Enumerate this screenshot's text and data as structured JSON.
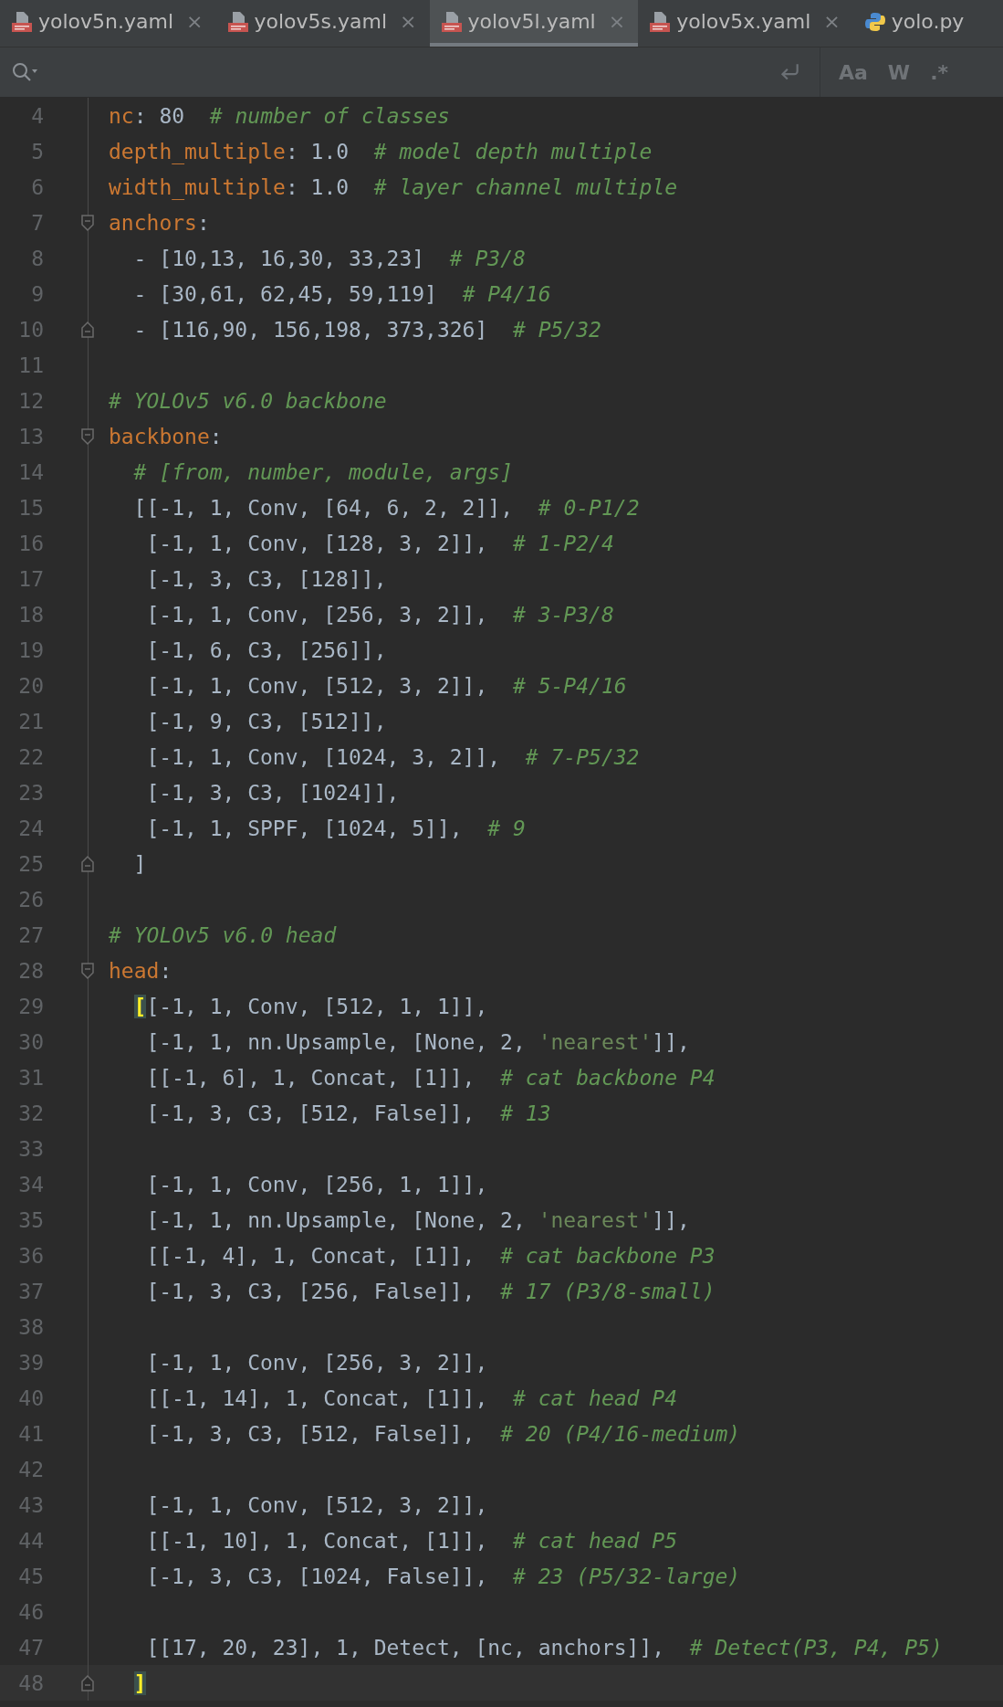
{
  "tabs": [
    {
      "label": "yolov5n.yaml",
      "kind": "yaml",
      "selected": false,
      "close": "×"
    },
    {
      "label": "yolov5s.yaml",
      "kind": "yaml",
      "selected": false,
      "close": "×"
    },
    {
      "label": "yolov5l.yaml",
      "kind": "yaml",
      "selected": true,
      "close": "×"
    },
    {
      "label": "yolov5x.yaml",
      "kind": "yaml",
      "selected": false,
      "close": "×"
    },
    {
      "label": "yolo.py",
      "kind": "python",
      "selected": false
    }
  ],
  "search_bar": {
    "match_case": "Aa",
    "words": "W",
    "regex": ".*"
  },
  "lines": [
    {
      "number": "4",
      "tokens": [
        {
          "kind": "key",
          "text": "nc"
        },
        {
          "kind": "plain",
          "text": ": 80  "
        },
        {
          "kind": "comment",
          "text": "# number of classes"
        }
      ]
    },
    {
      "number": "5",
      "tokens": [
        {
          "kind": "key",
          "text": "depth_multiple"
        },
        {
          "kind": "plain",
          "text": ": 1.0  "
        },
        {
          "kind": "comment",
          "text": "# model depth multiple"
        }
      ]
    },
    {
      "number": "6",
      "tokens": [
        {
          "kind": "key",
          "text": "width_multiple"
        },
        {
          "kind": "plain",
          "text": ": 1.0  "
        },
        {
          "kind": "comment",
          "text": "# layer channel multiple"
        }
      ]
    },
    {
      "number": "7",
      "fold_start": true,
      "tokens": [
        {
          "kind": "key",
          "text": "anchors"
        },
        {
          "kind": "plain",
          "text": ":"
        }
      ]
    },
    {
      "number": "8",
      "tokens": [
        {
          "kind": "plain",
          "text": "  - [10,13, 16,30, 33,23]  "
        },
        {
          "kind": "comment",
          "text": "# P3/8"
        }
      ]
    },
    {
      "number": "9",
      "tokens": [
        {
          "kind": "plain",
          "text": "  - [30,61, 62,45, 59,119]  "
        },
        {
          "kind": "comment",
          "text": "# P4/16"
        }
      ]
    },
    {
      "number": "10",
      "fold_end": true,
      "tokens": [
        {
          "kind": "plain",
          "text": "  - [116,90, 156,198, 373,326]  "
        },
        {
          "kind": "comment",
          "text": "# P5/32"
        }
      ]
    },
    {
      "number": "11"
    },
    {
      "number": "12",
      "tokens": [
        {
          "kind": "comment",
          "text": "# YOLOv5 v6.0 backbone"
        }
      ]
    },
    {
      "number": "13",
      "fold_start": true,
      "tokens": [
        {
          "kind": "key",
          "text": "backbone"
        },
        {
          "kind": "plain",
          "text": ":"
        }
      ]
    },
    {
      "number": "14",
      "tokens": [
        {
          "kind": "comment",
          "text": "  # [from, number, module, args]"
        }
      ]
    },
    {
      "number": "15",
      "tokens": [
        {
          "kind": "plain",
          "text": "  [[-1, 1, Conv, [64, 6, 2, 2]],  "
        },
        {
          "kind": "comment",
          "text": "# 0-P1/2"
        }
      ]
    },
    {
      "number": "16",
      "tokens": [
        {
          "kind": "plain",
          "text": "   [-1, 1, Conv, [128, 3, 2]],  "
        },
        {
          "kind": "comment",
          "text": "# 1-P2/4"
        }
      ]
    },
    {
      "number": "17",
      "tokens": [
        {
          "kind": "plain",
          "text": "   [-1, 3, C3, [128]],"
        }
      ]
    },
    {
      "number": "18",
      "tokens": [
        {
          "kind": "plain",
          "text": "   [-1, 1, Conv, [256, 3, 2]],  "
        },
        {
          "kind": "comment",
          "text": "# 3-P3/8"
        }
      ]
    },
    {
      "number": "19",
      "tokens": [
        {
          "kind": "plain",
          "text": "   [-1, 6, C3, [256]],"
        }
      ]
    },
    {
      "number": "20",
      "tokens": [
        {
          "kind": "plain",
          "text": "   [-1, 1, Conv, [512, 3, 2]],  "
        },
        {
          "kind": "comment",
          "text": "# 5-P4/16"
        }
      ]
    },
    {
      "number": "21",
      "tokens": [
        {
          "kind": "plain",
          "text": "   [-1, 9, C3, [512]],"
        }
      ]
    },
    {
      "number": "22",
      "tokens": [
        {
          "kind": "plain",
          "text": "   [-1, 1, Conv, [1024, 3, 2]],  "
        },
        {
          "kind": "comment",
          "text": "# 7-P5/32"
        }
      ]
    },
    {
      "number": "23",
      "tokens": [
        {
          "kind": "plain",
          "text": "   [-1, 3, C3, [1024]],"
        }
      ]
    },
    {
      "number": "24",
      "tokens": [
        {
          "kind": "plain",
          "text": "   [-1, 1, SPPF, [1024, 5]],  "
        },
        {
          "kind": "comment",
          "text": "# 9"
        }
      ]
    },
    {
      "number": "25",
      "fold_end": true,
      "tokens": [
        {
          "kind": "plain",
          "text": "  ]"
        }
      ]
    },
    {
      "number": "26"
    },
    {
      "number": "27",
      "tokens": [
        {
          "kind": "comment",
          "text": "# YOLOv5 v6.0 head"
        }
      ]
    },
    {
      "number": "28",
      "fold_start": true,
      "tokens": [
        {
          "kind": "key",
          "text": "head"
        },
        {
          "kind": "plain",
          "text": ":"
        }
      ]
    },
    {
      "number": "29",
      "tokens": [
        {
          "kind": "match",
          "text": "  ["
        },
        {
          "kind": "plain",
          "text": "[-1, 1, Conv, [512, 1, 1]],"
        }
      ]
    },
    {
      "number": "30",
      "tokens": [
        {
          "kind": "plain",
          "text": "   [-1, 1, nn.Upsample, [None, 2, "
        },
        {
          "kind": "string",
          "text": "'nearest'"
        },
        {
          "kind": "plain",
          "text": "]],"
        }
      ]
    },
    {
      "number": "31",
      "tokens": [
        {
          "kind": "plain",
          "text": "   [[-1, 6], 1, Concat, [1]],  "
        },
        {
          "kind": "comment",
          "text": "# cat backbone P4"
        }
      ]
    },
    {
      "number": "32",
      "tokens": [
        {
          "kind": "plain",
          "text": "   [-1, 3, C3, [512, False]],  "
        },
        {
          "kind": "comment",
          "text": "# 13"
        }
      ]
    },
    {
      "number": "33"
    },
    {
      "number": "34",
      "tokens": [
        {
          "kind": "plain",
          "text": "   [-1, 1, Conv, [256, 1, 1]],"
        }
      ]
    },
    {
      "number": "35",
      "tokens": [
        {
          "kind": "plain",
          "text": "   [-1, 1, nn.Upsample, [None, 2, "
        },
        {
          "kind": "string",
          "text": "'nearest'"
        },
        {
          "kind": "plain",
          "text": "]],"
        }
      ]
    },
    {
      "number": "36",
      "tokens": [
        {
          "kind": "plain",
          "text": "   [[-1, 4], 1, Concat, [1]],  "
        },
        {
          "kind": "comment",
          "text": "# cat backbone P3"
        }
      ]
    },
    {
      "number": "37",
      "tokens": [
        {
          "kind": "plain",
          "text": "   [-1, 3, C3, [256, False]],  "
        },
        {
          "kind": "comment",
          "text": "# 17 (P3/8-small)"
        }
      ]
    },
    {
      "number": "38"
    },
    {
      "number": "39",
      "tokens": [
        {
          "kind": "plain",
          "text": "   [-1, 1, Conv, [256, 3, 2]],"
        }
      ]
    },
    {
      "number": "40",
      "tokens": [
        {
          "kind": "plain",
          "text": "   [[-1, 14], 1, Concat, [1]],  "
        },
        {
          "kind": "comment",
          "text": "# cat head P4"
        }
      ]
    },
    {
      "number": "41",
      "tokens": [
        {
          "kind": "plain",
          "text": "   [-1, 3, C3, [512, False]],  "
        },
        {
          "kind": "comment",
          "text": "# 20 (P4/16-medium)"
        }
      ]
    },
    {
      "number": "42"
    },
    {
      "number": "43",
      "tokens": [
        {
          "kind": "plain",
          "text": "   [-1, 1, Conv, [512, 3, 2]],"
        }
      ]
    },
    {
      "number": "44",
      "tokens": [
        {
          "kind": "plain",
          "text": "   [[-1, 10], 1, Concat, [1]],  "
        },
        {
          "kind": "comment",
          "text": "# cat head P5"
        }
      ]
    },
    {
      "number": "45",
      "tokens": [
        {
          "kind": "plain",
          "text": "   [-1, 3, C3, [1024, False]],  "
        },
        {
          "kind": "comment",
          "text": "# 23 (P5/32-large)"
        }
      ]
    },
    {
      "number": "46"
    },
    {
      "number": "47",
      "tokens": [
        {
          "kind": "plain",
          "text": "   [[17, 20, 23], 1, Detect, [nc, anchors]],  "
        },
        {
          "kind": "comment",
          "text": "# Detect(P3, P4, P5)"
        }
      ]
    },
    {
      "number": "48",
      "fold_end": true,
      "current": true,
      "tokens": [
        {
          "kind": "match",
          "text": "  ]"
        }
      ]
    }
  ]
}
